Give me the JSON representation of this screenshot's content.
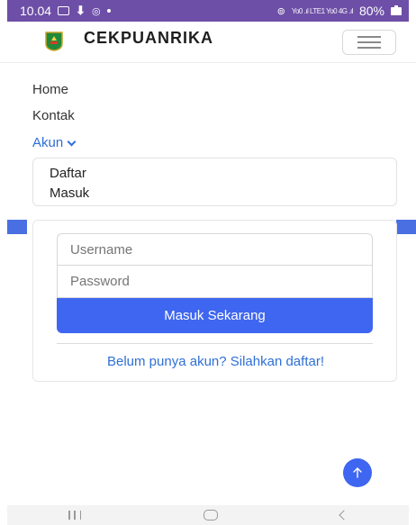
{
  "status_bar": {
    "time": "10.04",
    "network": "Yo0 .ıl LTE1 Yo0 4G .ıl",
    "battery": "80%",
    "bg_color": "#6e4fa7"
  },
  "navbar": {
    "brand": "CEKPUANRIKA",
    "logo_icon": "riau-emblem-icon",
    "menu_icon": "hamburger-icon"
  },
  "menu": {
    "items": [
      {
        "label": "Home"
      },
      {
        "label": "Kontak"
      },
      {
        "label": "Akun"
      }
    ],
    "dropdown": [
      {
        "label": "Daftar"
      },
      {
        "label": "Masuk"
      }
    ]
  },
  "login": {
    "username_placeholder": "Username",
    "password_placeholder": "Password",
    "submit_label": "Masuk Sekarang",
    "register_link": "Belum punya akun? Silahkan daftar!"
  },
  "colors": {
    "accent": "#3f66f0",
    "link": "#2f6fd6"
  }
}
